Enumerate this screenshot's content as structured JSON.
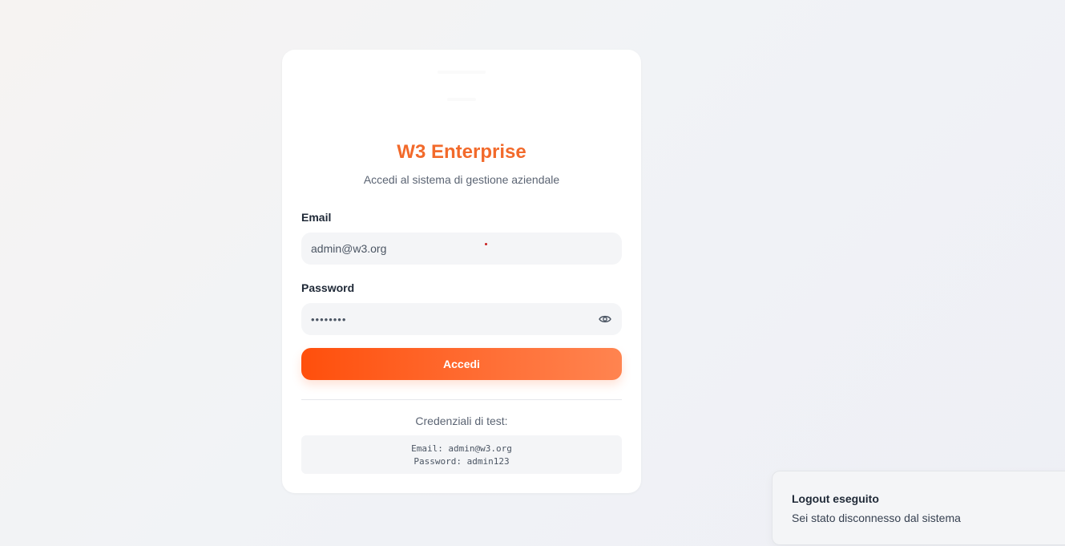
{
  "login": {
    "title": "W3 Enterprise",
    "subtitle": "Accedi al sistema di gestione aziendale",
    "email_label": "Email",
    "email_value": "admin@w3.org",
    "password_label": "Password",
    "password_value": "••••••••",
    "password_toggle_icon": "eye-icon",
    "submit_label": "Accedi",
    "test_credentials_title": "Credenziali di test:",
    "test_email_line": "Email: admin@w3.org",
    "test_password_line": "Password: admin123"
  },
  "toast": {
    "title": "Logout eseguito",
    "description": "Sei stato disconnesso dal sistema"
  },
  "colors": {
    "accent": "#f26a2b",
    "button_start": "#ff4f0c",
    "button_end": "#ff8450"
  }
}
